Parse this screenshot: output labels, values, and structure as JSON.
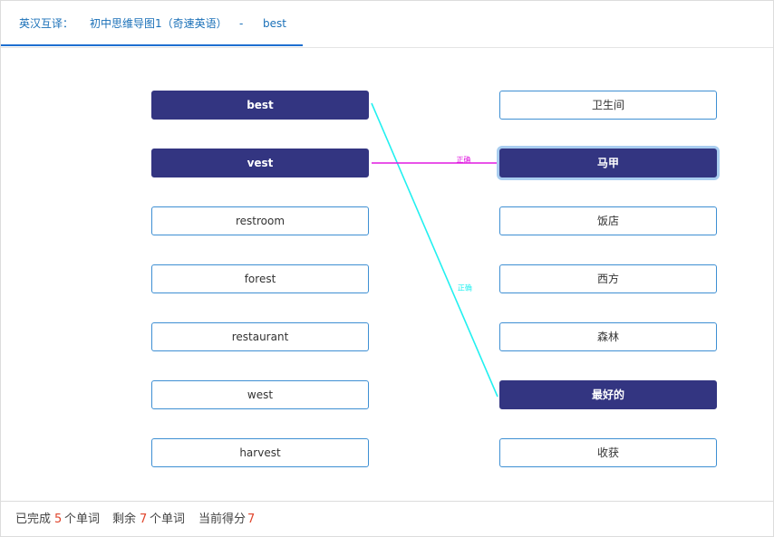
{
  "header": {
    "mode_label": "英汉互译：",
    "book_title": "初中思维导图1（奇速英语）",
    "separator": "-",
    "current_word": "best"
  },
  "left_words": [
    "best",
    "vest",
    "restroom",
    "forest",
    "restaurant",
    "west",
    "harvest"
  ],
  "right_words": [
    "卫生间",
    "马甲",
    "饭店",
    "西方",
    "森林",
    "最好的",
    "收获"
  ],
  "selected": {
    "left": [
      0,
      1
    ],
    "right": [
      1,
      5
    ]
  },
  "links": [
    {
      "from": 0,
      "to": 5,
      "label": "正确",
      "color": "#22f0f0"
    },
    {
      "from": 1,
      "to": 1,
      "label": "正确",
      "color": "#e01ae0"
    }
  ],
  "footer": {
    "completed_prefix": "已完成",
    "completed_count": "5",
    "completed_unit": "个单词",
    "remaining_prefix": "剩余",
    "remaining_count": "7",
    "remaining_unit": "个单词",
    "score_prefix": "当前得分",
    "score_value": "7"
  },
  "colors": {
    "selected_fill": "#333581",
    "box_border": "#3e8fd3",
    "count_color": "#e0452c"
  }
}
